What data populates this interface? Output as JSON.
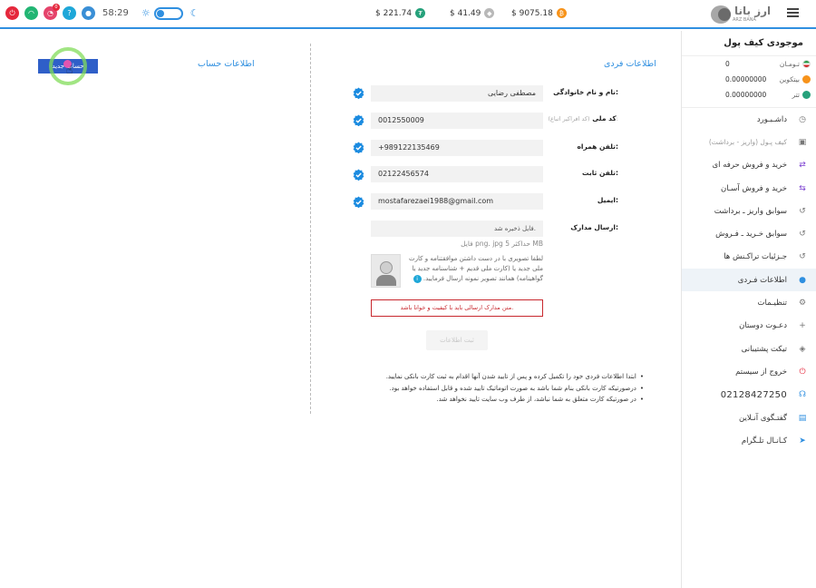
{
  "topbar": {
    "time": "58:29",
    "notification_count": "0",
    "prices": [
      {
        "value": "$ 221.74",
        "coin": "tether-icon"
      },
      {
        "value": "$ 41.49",
        "coin": "ethereum-icon"
      },
      {
        "value": "$ 9075.18",
        "coin": "bitcoin-icon"
      }
    ],
    "logo_text": "ارز بانا",
    "logo_sub": "ARZ BANA"
  },
  "sidebar": {
    "wallet_title": "موجودی کیف پول",
    "wallet": [
      {
        "name": "تـومـان",
        "value": "0"
      },
      {
        "name": "بیتکوین",
        "value": "0.00000000"
      },
      {
        "name": "تتر",
        "value": "0.00000000"
      }
    ],
    "items": [
      {
        "label": "داشـبـورد",
        "icon": "dashboard-icon"
      },
      {
        "label": "کیف پـول (واریز - برداشت)",
        "icon": "wallet-icon"
      },
      {
        "label": "خرید و فروش حرفه ای",
        "icon": "exchange-pro-icon"
      },
      {
        "label": "خرید و فروش آسـان",
        "icon": "exchange-easy-icon"
      },
      {
        "label": "سوابق واریز ـ برداشت",
        "icon": "history-icon"
      },
      {
        "label": "سوابق خـرید ـ فـروش",
        "icon": "history-icon"
      },
      {
        "label": "جـزئیات تراکـنش ها",
        "icon": "history-icon"
      },
      {
        "label": "اطلاعات فـردی",
        "icon": "user-icon"
      },
      {
        "label": "تنظیـمات",
        "icon": "gear-icon"
      },
      {
        "label": "دعـوت دوستان",
        "icon": "add-user-icon"
      },
      {
        "label": "تیکت پشتیبانی",
        "icon": "tag-icon"
      },
      {
        "label": "خروج از سیستم",
        "icon": "power-icon"
      },
      {
        "label": "02128427250",
        "icon": "headset-icon"
      },
      {
        "label": "گفتـگوی آنـلاین",
        "icon": "chat-icon"
      },
      {
        "label": "کـانـال تلـگرام",
        "icon": "telegram-icon"
      }
    ]
  },
  "personal": {
    "title": "اطلاعات فردی",
    "fields": [
      {
        "label": "نام و نام خانوادگی:",
        "hint": "",
        "value": "مصطفی رضایی"
      },
      {
        "label": "کد ملی",
        "hint": "(کد افراکیر اتباع):",
        "value": "0012550009"
      },
      {
        "label": "تلفن همراه:",
        "hint": "",
        "value": "+989122135469"
      },
      {
        "label": "تلفن ثابت:",
        "hint": "",
        "value": "02122456574"
      },
      {
        "label": "ایمیل:",
        "hint": "",
        "value": "mostafarezaei1988@gmail.com"
      }
    ],
    "docs_label": "ارسال مدارک:",
    "docs_saved": "فایل ذخیره شد.",
    "docs_limit": "فایل png. jpg حداکثر 5 MB",
    "docs_desc": "لطفا تصویری با در دست داشتن موافقتنامه و کارت ملی جدید یا (کارت ملی قدیم + شناسنامه جدید یا گواهینامه) همانند تصویر نمونه ارسال فرمایید.",
    "docs_warning": "متن مدارک ارسالی باید با کیفیت و خوانا باشد.",
    "submit": "ثبت اطلاعات",
    "notes": [
      "ابتدا اطلاعات فردی خود را تکمیل کرده و پس از تایید شدن آنها اقدام به ثبت کارت بانکی نمایید.",
      "درصورتیکه کارت بانکی بنام شما باشد به صورت اتوماتیک تایید شده و قابل استفاده خواهد بود.",
      "در صورتیکه کارت متعلق به شما نباشد، از طرف وب سایت تایید نخواهد شد."
    ]
  },
  "account": {
    "title": "اطلاعات حساب",
    "button": "حساب جدید"
  },
  "colors": {
    "accent": "#2f8fe0",
    "danger": "#c8282e",
    "button": "#2f5fc8"
  }
}
